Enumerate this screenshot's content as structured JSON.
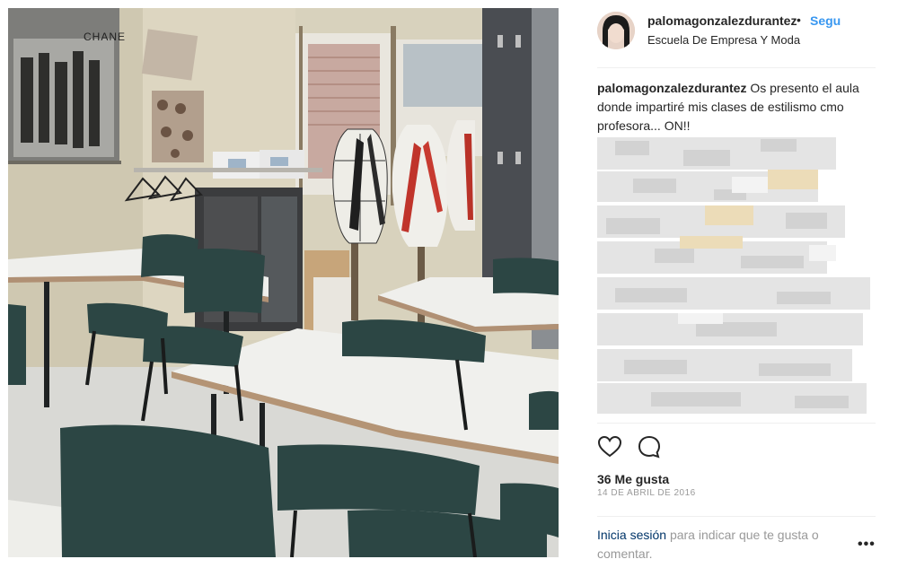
{
  "header": {
    "username": "palomagonzalezdurantez",
    "separator": "•",
    "follow_label": "Segu",
    "location": "Escuela De Empresa Y Moda"
  },
  "photo": {
    "poster_text": "CHANE"
  },
  "caption": {
    "username": "palomagonzalezdurantez",
    "text": "Os presento el aula donde impartiré mis clases de estilismo cmo profesora... ON!!"
  },
  "actions": {
    "like_icon": "heart-icon",
    "comment_icon": "comment-icon"
  },
  "likes": "36 Me gusta",
  "date": "14 DE ABRIL DE 2016",
  "footer": {
    "login_link": "Inicia sesión",
    "login_text": "para indicar que te gusta o comentar.",
    "more_label": "•••"
  },
  "colors": {
    "accent": "#3897f0",
    "text": "#262626",
    "muted": "#999999",
    "link": "#003569"
  }
}
